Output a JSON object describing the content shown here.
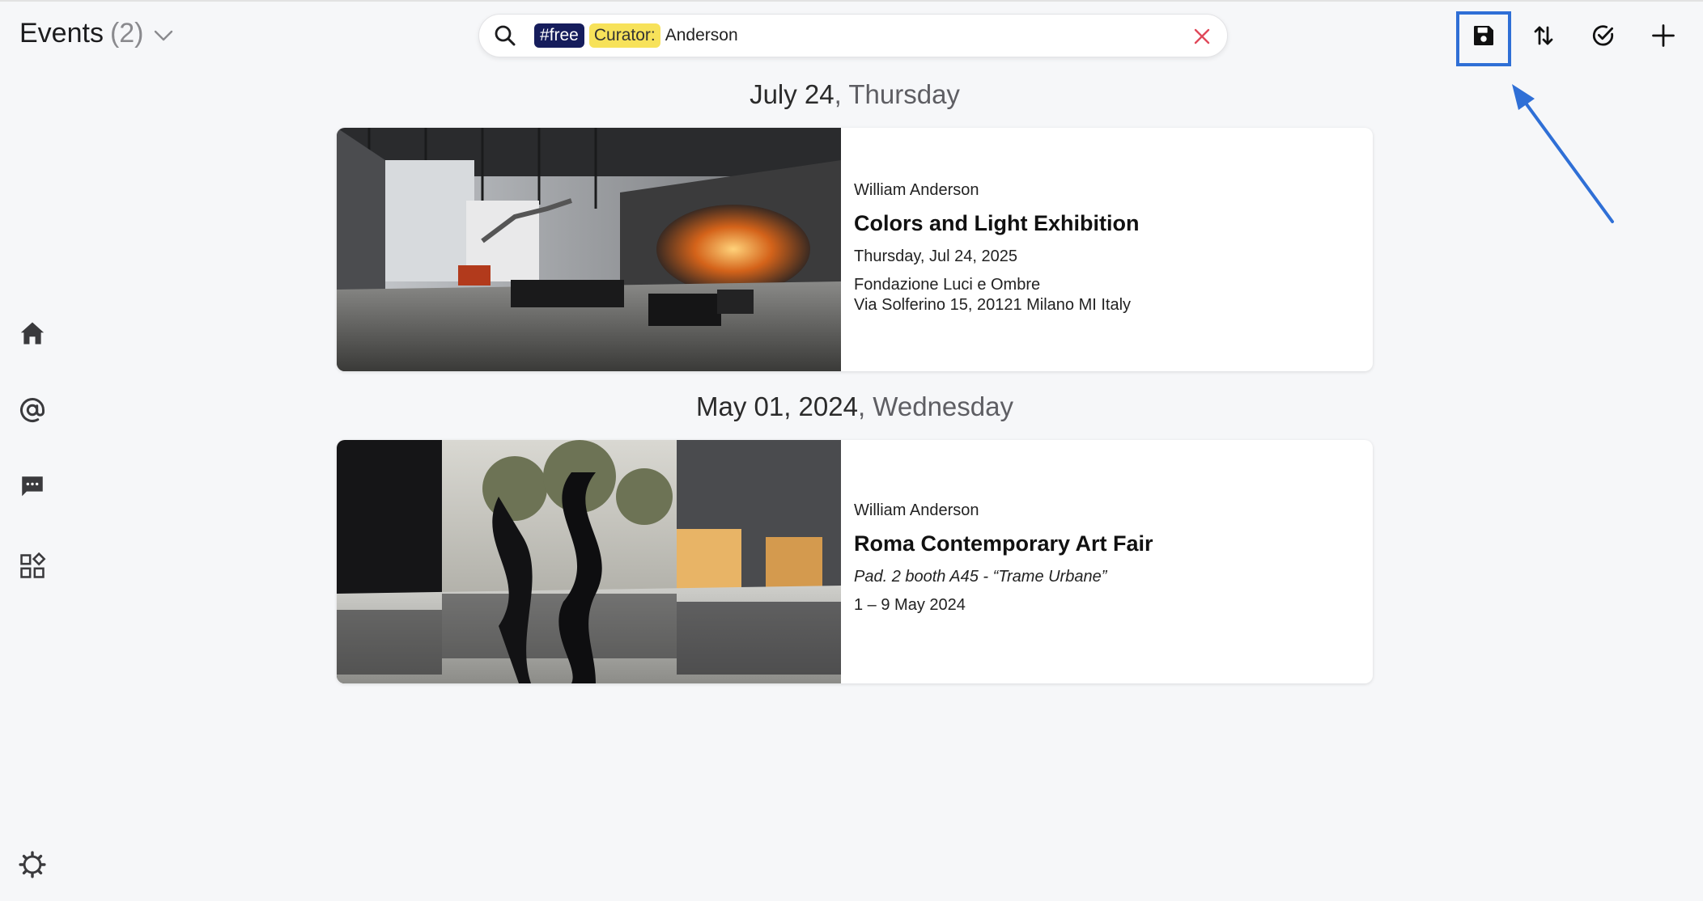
{
  "header": {
    "title": "Events",
    "count": "(2)"
  },
  "search": {
    "tag_free": "#free",
    "tag_curator_label": "Curator:",
    "tag_curator_value": "Anderson"
  },
  "toolbar": {
    "icons": [
      "save-icon",
      "sort-icon",
      "select-check-icon",
      "add-icon"
    ],
    "highlight_color": "#2f6fd6"
  },
  "sidebar": {
    "icons": [
      "home-icon",
      "mentions-icon",
      "messages-icon",
      "apps-icon",
      "settings-icon"
    ]
  },
  "events": [
    {
      "date": "July 24",
      "weekday": ", Thursday",
      "curator": "William Anderson",
      "title": "Colors and Light Exhibition",
      "line1": "Thursday, Jul 24, 2025",
      "line2": "Fondazione Luci e Ombre",
      "line3": "Via Solferino 15, 20121 Milano MI Italy"
    },
    {
      "date": "May 01, 2024",
      "weekday": ", Wednesday",
      "curator": "William Anderson",
      "title": "Roma Contemporary Art Fair",
      "line1": "Pad. 2 booth A45 - “Trame Urbane”",
      "line2": "1 – 9 May 2024"
    }
  ],
  "colors": {
    "tag_free_bg": "#161d5c",
    "tag_curator_bg": "#f7e25a",
    "clear_x": "#e0495a",
    "background": "#f6f7f9"
  }
}
